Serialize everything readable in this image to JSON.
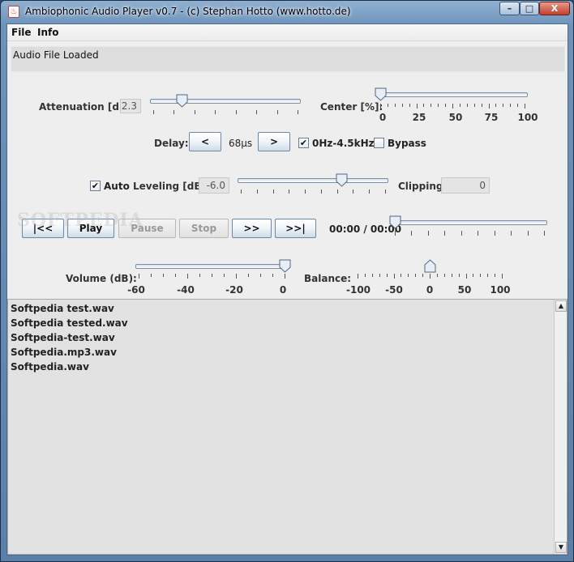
{
  "window": {
    "title": "Ambiophonic Audio Player v0.7 - (c) Stephan Hotto (www.hotto.de)",
    "controls": {
      "minimize": "–",
      "maximize": "□",
      "close": "X"
    }
  },
  "menu": {
    "file": "File",
    "info": "Info"
  },
  "status": "Audio File Loaded",
  "attenuation": {
    "label": "Attenuation [dB]:",
    "value": "2.3",
    "slider_fraction": 0.2
  },
  "center": {
    "label": "Center [%]:",
    "tick_labels": [
      "0",
      "25",
      "50",
      "75",
      "100"
    ],
    "value_percent": 0
  },
  "delay": {
    "label": "Delay:",
    "decrease": "<",
    "value": "68µs",
    "increase": ">"
  },
  "filter": {
    "label": "0Hz-4.5kHz",
    "checked": true
  },
  "bypass": {
    "label": "Bypass",
    "checked": false
  },
  "auto": {
    "label": "Auto",
    "checked": true
  },
  "leveling": {
    "label": "Leveling [dB]:",
    "value": "-6.0",
    "slider_fraction": 0.7
  },
  "clipping": {
    "label": "Clipping:",
    "value": "0"
  },
  "transport": {
    "first": "|<<",
    "play": "Play",
    "pause": "Pause",
    "stop": "Stop",
    "forward": ">>",
    "last": ">>|"
  },
  "time": {
    "display": "00:00 / 00:00",
    "position_fraction": 0
  },
  "volume": {
    "label": "Volume (dB):",
    "tick_labels": [
      "-60",
      "-40",
      "-20",
      "0"
    ],
    "value_db": 0
  },
  "balance": {
    "label": "Balance:",
    "tick_labels": [
      "-100",
      "-50",
      "0",
      "50",
      "100"
    ],
    "value": 0
  },
  "playlist": [
    "Softpedia test.wav",
    "Softpedia tested.wav",
    "Softpedia-test.wav",
    "Softpedia.mp3.wav",
    "Softpedia.wav"
  ],
  "scroll": {
    "up": "▲",
    "down": "▼"
  },
  "watermark": "SOFTPEDIA",
  "colors": {
    "panel": "#eeeeee",
    "titlebar": "#6e93bb",
    "playlist_bg": "#e2e2e2"
  }
}
